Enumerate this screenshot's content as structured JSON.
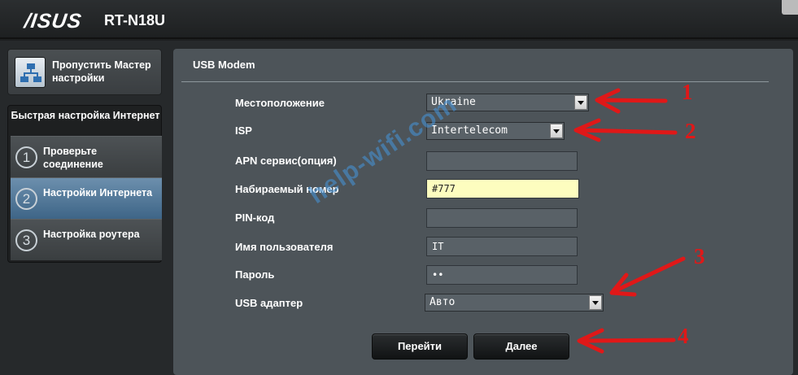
{
  "header": {
    "brand": "/ISUS",
    "model": "RT-N18U"
  },
  "sidebar": {
    "skip_wizard": "Пропустить Мастер настройки",
    "quick_setup_title": "Быстрая настройка Интернет",
    "steps": [
      {
        "num": "1",
        "label": "Проверьте соединение",
        "active": false
      },
      {
        "num": "2",
        "label": "Настройки Интернета",
        "active": true
      },
      {
        "num": "3",
        "label": "Настройка роутера",
        "active": false
      }
    ]
  },
  "main": {
    "title": "USB Modem",
    "fields": {
      "location": {
        "label": "Местоположение",
        "value": "Ukraine"
      },
      "isp": {
        "label": "ISP",
        "value": "Intertelecom"
      },
      "apn": {
        "label": "APN сервис(опция)",
        "value": ""
      },
      "dial_number": {
        "label": "Набираемый номер",
        "value": "#777"
      },
      "pin": {
        "label": "PIN-код",
        "value": ""
      },
      "username": {
        "label": "Имя пользователя",
        "value": "IT"
      },
      "password": {
        "label": "Пароль",
        "value": "••"
      },
      "usb_adapter": {
        "label": "USB адаптер",
        "value": "Авто"
      }
    },
    "buttons": {
      "go": "Перейти",
      "next": "Далее"
    }
  },
  "annotations": {
    "numbers": [
      "1",
      "2",
      "3",
      "4"
    ],
    "watermark": "help-wifi.com",
    "arrow_color": "#e01818"
  }
}
